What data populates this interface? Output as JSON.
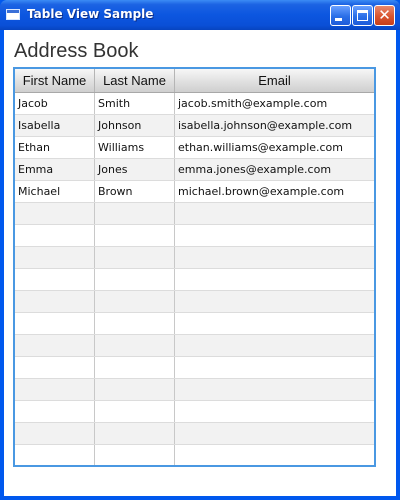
{
  "window": {
    "title": "Table View Sample"
  },
  "page": {
    "title": "Address Book"
  },
  "table": {
    "columns": [
      "First Name",
      "Last Name",
      "Email"
    ],
    "rows": [
      [
        "Jacob",
        "Smith",
        "jacob.smith@example.com"
      ],
      [
        "Isabella",
        "Johnson",
        "isabella.johnson@example.com"
      ],
      [
        "Ethan",
        "Williams",
        "ethan.williams@example.com"
      ],
      [
        "Emma",
        "Jones",
        "emma.jones@example.com"
      ],
      [
        "Michael",
        "Brown",
        "michael.brown@example.com"
      ],
      [
        "",
        "",
        ""
      ],
      [
        "",
        "",
        ""
      ],
      [
        "",
        "",
        ""
      ],
      [
        "",
        "",
        ""
      ],
      [
        "",
        "",
        ""
      ],
      [
        "",
        "",
        ""
      ],
      [
        "",
        "",
        ""
      ],
      [
        "",
        "",
        ""
      ],
      [
        "",
        "",
        ""
      ],
      [
        "",
        "",
        ""
      ],
      [
        "",
        "",
        ""
      ],
      [
        "",
        "",
        ""
      ]
    ]
  },
  "icons": {
    "window": "app-window-icon",
    "minimize": "minimize-icon",
    "maximize": "maximize-icon",
    "close": "close-icon"
  },
  "colors": {
    "titlebar": "#0a4fd6",
    "table_border": "#4a98e2",
    "close_button": "#d9542f"
  }
}
